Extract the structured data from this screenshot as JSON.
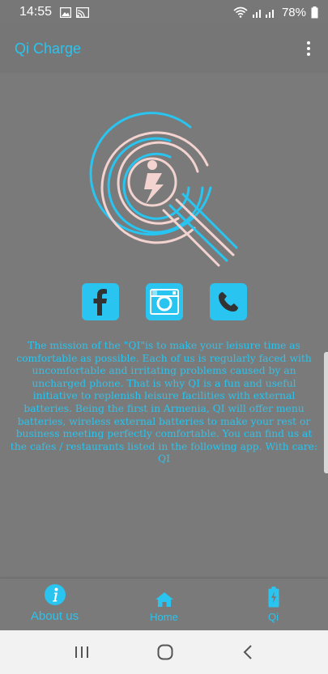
{
  "status_bar": {
    "time": "14:55",
    "battery": "78%"
  },
  "app_bar": {
    "title": "Qi Charge"
  },
  "social": [
    "facebook",
    "instagram",
    "phone"
  ],
  "mission_text": "The mission of the \"QI\"is to make your leisure time as comfortable as possible. Each of us is regularly faced with uncomfortable and irritating problems caused by an uncharged phone. That is why QI is a fun and useful initiative to replenish leisure facilities with external batteries. Being the first in Armenia, QI will offer menu batteries, wireless external batteries to make your rest or business meeting perfectly comfortable. You can find us at the cafes / restaurants listed in the following app. With care: QI",
  "bottom_nav": [
    {
      "label": "About us",
      "icon": "info-icon",
      "active": true
    },
    {
      "label": "Home",
      "icon": "home-icon",
      "active": false
    },
    {
      "label": "Qi",
      "icon": "battery-charge-icon",
      "active": false
    }
  ],
  "colors": {
    "accent": "#29c4ef",
    "background": "#7a7a7a",
    "logo_pink": "#f2d3d0"
  }
}
